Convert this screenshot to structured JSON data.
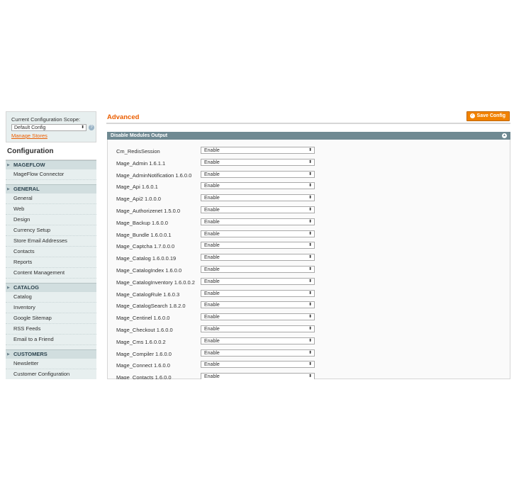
{
  "sidebar": {
    "scope_label": "Current Configuration Scope:",
    "scope_value": "Default Config",
    "manage_stores": "Manage Stores",
    "config_title": "Configuration",
    "groups": [
      {
        "title": "MAGEFLOW",
        "items": [
          "MageFlow Connector"
        ]
      },
      {
        "title": "GENERAL",
        "items": [
          "General",
          "Web",
          "Design",
          "Currency Setup",
          "Store Email Addresses",
          "Contacts",
          "Reports",
          "Content Management"
        ]
      },
      {
        "title": "CATALOG",
        "items": [
          "Catalog",
          "Inventory",
          "Google Sitemap",
          "RSS Feeds",
          "Email to a Friend"
        ]
      },
      {
        "title": "CUSTOMERS",
        "items": [
          "Newsletter",
          "Customer Configuration"
        ]
      }
    ]
  },
  "main": {
    "title": "Advanced",
    "save_button": "Save Config",
    "fieldset_title": "Disable Modules Output",
    "modules": [
      {
        "name": "Cm_RedisSession",
        "value": "Enable"
      },
      {
        "name": "Mage_Admin 1.6.1.1",
        "value": "Enable"
      },
      {
        "name": "Mage_AdminNotification 1.6.0.0",
        "value": "Enable"
      },
      {
        "name": "Mage_Api 1.6.0.1",
        "value": "Enable"
      },
      {
        "name": "Mage_Api2 1.0.0.0",
        "value": "Enable"
      },
      {
        "name": "Mage_Authorizenet 1.5.0.0",
        "value": "Enable"
      },
      {
        "name": "Mage_Backup 1.6.0.0",
        "value": "Enable"
      },
      {
        "name": "Mage_Bundle 1.6.0.0.1",
        "value": "Enable"
      },
      {
        "name": "Mage_Captcha 1.7.0.0.0",
        "value": "Enable"
      },
      {
        "name": "Mage_Catalog 1.6.0.0.19",
        "value": "Enable"
      },
      {
        "name": "Mage_CatalogIndex 1.6.0.0",
        "value": "Enable"
      },
      {
        "name": "Mage_CatalogInventory 1.6.0.0.2",
        "value": "Enable"
      },
      {
        "name": "Mage_CatalogRule 1.6.0.3",
        "value": "Enable"
      },
      {
        "name": "Mage_CatalogSearch 1.8.2.0",
        "value": "Enable"
      },
      {
        "name": "Mage_Centinel 1.6.0.0",
        "value": "Enable"
      },
      {
        "name": "Mage_Checkout 1.6.0.0",
        "value": "Enable"
      },
      {
        "name": "Mage_Cms 1.6.0.0.2",
        "value": "Enable"
      },
      {
        "name": "Mage_Compiler 1.6.0.0",
        "value": "Enable"
      },
      {
        "name": "Mage_Connect 1.6.0.0",
        "value": "Enable"
      },
      {
        "name": "Mage_Contacts 1.6.0.0",
        "value": "Enable"
      }
    ]
  },
  "icons": {
    "help": "help-icon",
    "save": "save-icon",
    "collapse": "collapse-icon",
    "group_toggle": "triangle-right-icon",
    "dropdown": "select-arrows-icon"
  },
  "colors": {
    "accent": "#eb5e00",
    "button": "#f18200",
    "fieldset_header": "#6f8992",
    "sidebar_bg": "#e7efef",
    "group_header_bg": "#d1dedf"
  }
}
